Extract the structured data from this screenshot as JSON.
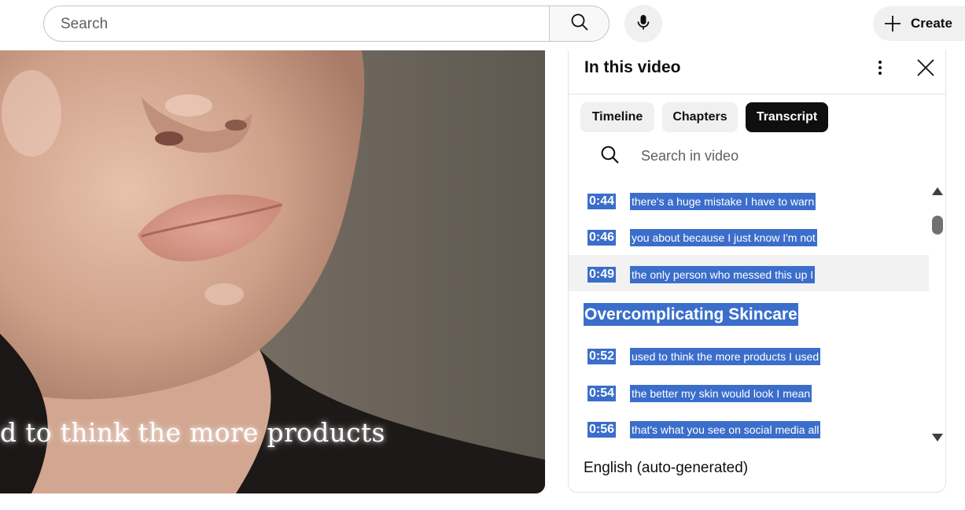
{
  "search": {
    "placeholder": "Search"
  },
  "icons": {
    "search": "search-icon",
    "mic": "microphone-icon",
    "create": "plus-icon",
    "kebab": "more-vert-icon",
    "close": "close-icon"
  },
  "create_label": "Create",
  "video": {
    "caption": "d to think the more products"
  },
  "panel": {
    "title": "In this video",
    "tabs": [
      {
        "label": "Timeline",
        "active": false
      },
      {
        "label": "Chapters",
        "active": false
      },
      {
        "label": "Transcript",
        "active": true
      }
    ],
    "search_placeholder": "Search in video",
    "segments": [
      {
        "time": "0:44",
        "text": "there's a huge mistake I have to warn"
      },
      {
        "time": "0:46",
        "text": "you about because I just know I'm not"
      },
      {
        "time": "0:49",
        "text": "the only person who messed this up I"
      }
    ],
    "chapter_title": "Overcomplicating Skincare",
    "segments_after": [
      {
        "time": "0:52",
        "text": "used to think the more products I used"
      },
      {
        "time": "0:54",
        "text": "the better my skin would look I mean"
      },
      {
        "time": "0:56",
        "text": "that's what you see on social media all"
      }
    ],
    "language": "English (auto-generated)"
  },
  "colors": {
    "selection": "#3b6ecb",
    "active_chip": "#0f0f0f",
    "chip": "#f0f0f0"
  }
}
